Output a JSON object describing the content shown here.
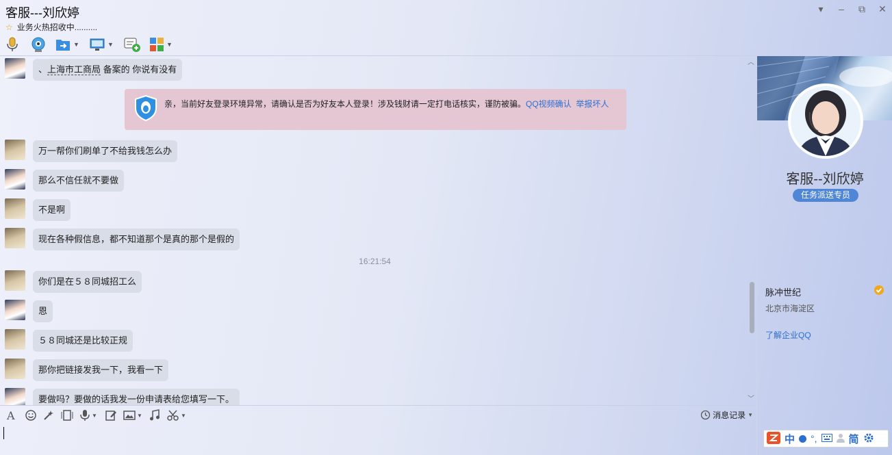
{
  "window": {
    "title": "客服---刘欣婷",
    "signature": "业务火热招收中.........."
  },
  "toolbar": {
    "icons": [
      "microphone-icon",
      "webcam-icon",
      "file-transfer-icon",
      "remote-desktop-icon",
      "add-discussion-icon",
      "apps-icon"
    ]
  },
  "notice": {
    "text": "亲，当前好友登录环境异常，请确认是否为好友本人登录！涉及钱财请一定打电话核实，谨防被骗。",
    "link_video": "QQ视频确认",
    "link_report": "举报坏人"
  },
  "messages": {
    "m0_pre": "、",
    "m0_link": "上海市工商局",
    "m0_post": " 备案的  你说有没有",
    "m1": "万一帮你们刷单了不给我钱怎么办",
    "m2": "那么不信任就不要做",
    "m3": "不是啊",
    "m4": "现在各种假信息，都不知道那个是真的那个是假的",
    "timestamp": "16:21:54",
    "m5": "你们是在５８同城招工么",
    "m6": "恩",
    "m7": "５８同城还是比较正规",
    "m8": "那你把链接发我一下，我看一下",
    "m9": "要做吗？要做的话我发一份申请表给您填写一下。"
  },
  "input_toolbar": {
    "history_label": "消息记录"
  },
  "profile": {
    "name": "客服--刘欣婷",
    "tag": "任务派送专员",
    "company": "脉冲世纪",
    "district": "北京市海淀区",
    "learn_more": "了解企业QQ"
  },
  "ime": {
    "lang": "中",
    "simplified": "简"
  },
  "colors": {
    "accent_link": "#2d6fd1",
    "tag_bg": "#4f86d6",
    "notice_bg": "#e4c7d2",
    "bubble_bg": "#d9dde8"
  }
}
